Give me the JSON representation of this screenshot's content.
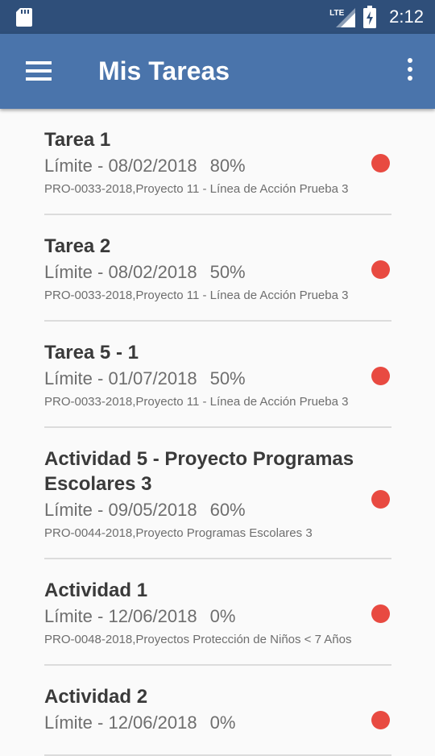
{
  "status_bar": {
    "network": "LTE",
    "time": "2:12"
  },
  "app_bar": {
    "title": "Mis Tareas"
  },
  "colors": {
    "status_bar": "#2f4f7a",
    "app_bar": "#4a74ab",
    "status_dot": "#e84a41"
  },
  "tasks": [
    {
      "title": "Tarea 1",
      "deadline": "Límite - 08/02/2018",
      "progress": "80%",
      "project": "PRO-0033-2018,Proyecto 11 - Línea de Acción Prueba 3"
    },
    {
      "title": "Tarea 2",
      "deadline": "Límite - 08/02/2018",
      "progress": "50%",
      "project": "PRO-0033-2018,Proyecto 11 - Línea de Acción Prueba 3"
    },
    {
      "title": "Tarea 5 - 1",
      "deadline": "Límite - 01/07/2018",
      "progress": "50%",
      "project": "PRO-0033-2018,Proyecto 11 - Línea de Acción Prueba 3"
    },
    {
      "title": "Actividad 5 - Proyecto Programas Escolares 3",
      "deadline": "Límite - 09/05/2018",
      "progress": "60%",
      "project": "PRO-0044-2018,Proyecto Programas Escolares 3"
    },
    {
      "title": "Actividad 1",
      "deadline": "Límite - 12/06/2018",
      "progress": "0%",
      "project": "PRO-0048-2018,Proyectos Protección de Niños < 7 Años"
    },
    {
      "title": "Actividad 2",
      "deadline": "Límite - 12/06/2018",
      "progress": "0%",
      "project": ""
    }
  ]
}
